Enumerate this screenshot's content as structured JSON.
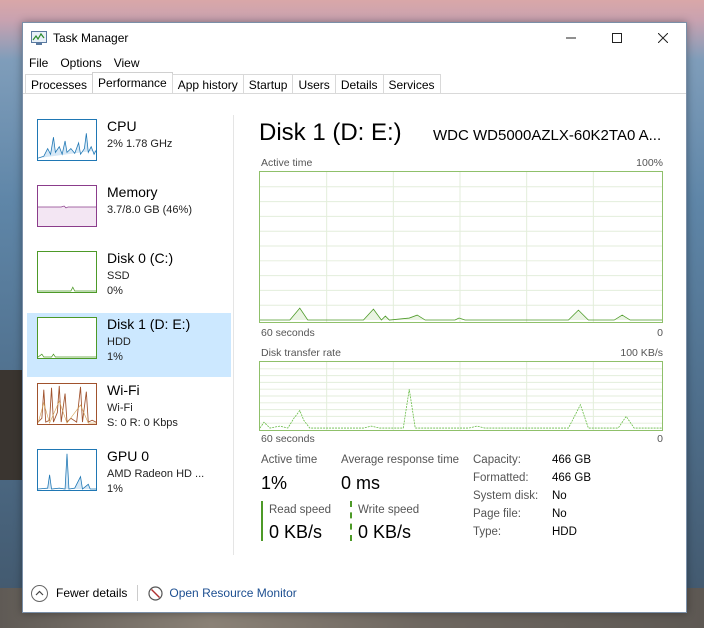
{
  "window": {
    "title": "Task Manager"
  },
  "menu": [
    "File",
    "Options",
    "View"
  ],
  "tabs": [
    "Processes",
    "Performance",
    "App history",
    "Startup",
    "Users",
    "Details",
    "Services"
  ],
  "active_tab": "Performance",
  "sidebar": [
    {
      "name": "CPU",
      "line1": "2%  1.78 GHz",
      "line2": "",
      "color": "#1f77b4"
    },
    {
      "name": "Memory",
      "line1": "3.7/8.0 GB (46%)",
      "line2": "",
      "color": "#8b3d8b"
    },
    {
      "name": "Disk 0 (C:)",
      "line1": "SSD",
      "line2": "0%",
      "color": "#4d9a28"
    },
    {
      "name": "Disk 1 (D: E:)",
      "line1": "HDD",
      "line2": "1%",
      "color": "#4d9a28"
    },
    {
      "name": "Wi-Fi",
      "line1": "Wi-Fi",
      "line2": "S: 0  R: 0 Kbps",
      "color": "#a0522d"
    },
    {
      "name": "GPU 0",
      "line1": "AMD Radeon HD ...",
      "line2": "1%",
      "color": "#1f77b4"
    }
  ],
  "main": {
    "title": "Disk 1 (D: E:)",
    "model": "WDC WD5000AZLX-60K2TA0 A...",
    "graph1": {
      "label": "Active time",
      "max": "100%",
      "time_left": "60 seconds",
      "time_right": "0"
    },
    "graph2": {
      "label": "Disk transfer rate",
      "max": "100 KB/s",
      "time_left": "60 seconds",
      "time_right": "0"
    },
    "stats": {
      "active_time_label": "Active time",
      "active_time_value": "1%",
      "avg_response_label": "Average response time",
      "avg_response_value": "0 ms",
      "read_label": "Read speed",
      "read_value": "0 KB/s",
      "write_label": "Write speed",
      "write_value": "0 KB/s"
    },
    "props": [
      {
        "label": "Capacity:",
        "value": "466 GB"
      },
      {
        "label": "Formatted:",
        "value": "466 GB"
      },
      {
        "label": "System disk:",
        "value": "No"
      },
      {
        "label": "Page file:",
        "value": "No"
      },
      {
        "label": "Type:",
        "value": "HDD"
      }
    ]
  },
  "footer": {
    "fewer_details": "Fewer details",
    "resource_monitor": "Open Resource Monitor"
  }
}
